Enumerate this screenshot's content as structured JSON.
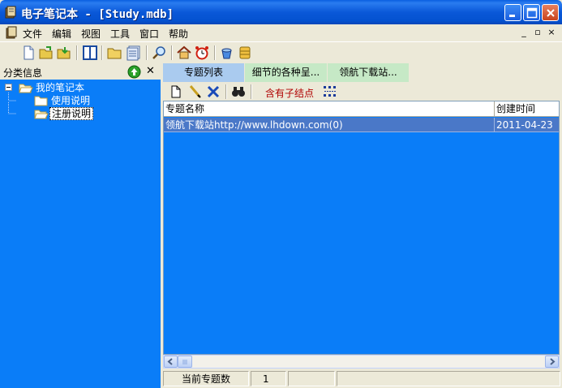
{
  "window": {
    "title": "电子笔记本 - [Study.mdb]",
    "app_icon": "notebook-icon",
    "controls": [
      "minimize-icon",
      "maximize-icon",
      "close-icon"
    ]
  },
  "menu": {
    "items": [
      "文件",
      "编辑",
      "视图",
      "工具",
      "窗口",
      "帮助"
    ],
    "mdi_controls": [
      "_",
      "▫",
      "×"
    ]
  },
  "toolbar": {
    "icons": [
      "new-doc-icon",
      "open-folder-icon",
      "save-folder-icon",
      "split-view-icon",
      "folder-icon",
      "notes-icon",
      "search-icon",
      "home-icon",
      "alarm-clock-icon",
      "cup-icon",
      "database-icon"
    ]
  },
  "left_panel": {
    "title": "分类信息",
    "close_symbol": "✕",
    "tree": {
      "root": "我的笔记本",
      "children": [
        "使用说明",
        "注册说明"
      ],
      "selected": "注册说明"
    }
  },
  "tabs": [
    {
      "label": "专题列表"
    },
    {
      "label": "细节的各种呈..."
    },
    {
      "label": "领航下载站..."
    }
  ],
  "subtoolbar": {
    "child_label": "含有子结点",
    "icons": [
      "new-doc-icon",
      "edit-pencil-icon",
      "delete-x-icon",
      "binoculars-icon",
      "tree-structure-icon"
    ]
  },
  "table": {
    "columns": [
      "专题名称",
      "创建时间"
    ],
    "rows": [
      {
        "name": "领航下载站http://www.lhdown.com(0)",
        "date": "2011-04-23"
      }
    ]
  },
  "status": {
    "label": "当前专题数",
    "count": "1"
  },
  "colors": {
    "panel_bg": "#0a7df8",
    "selected_row": "#4a78c8",
    "tab_active": "#aacbef",
    "tab_inactive": "#c6e9c6",
    "child_label": "#b00000"
  }
}
